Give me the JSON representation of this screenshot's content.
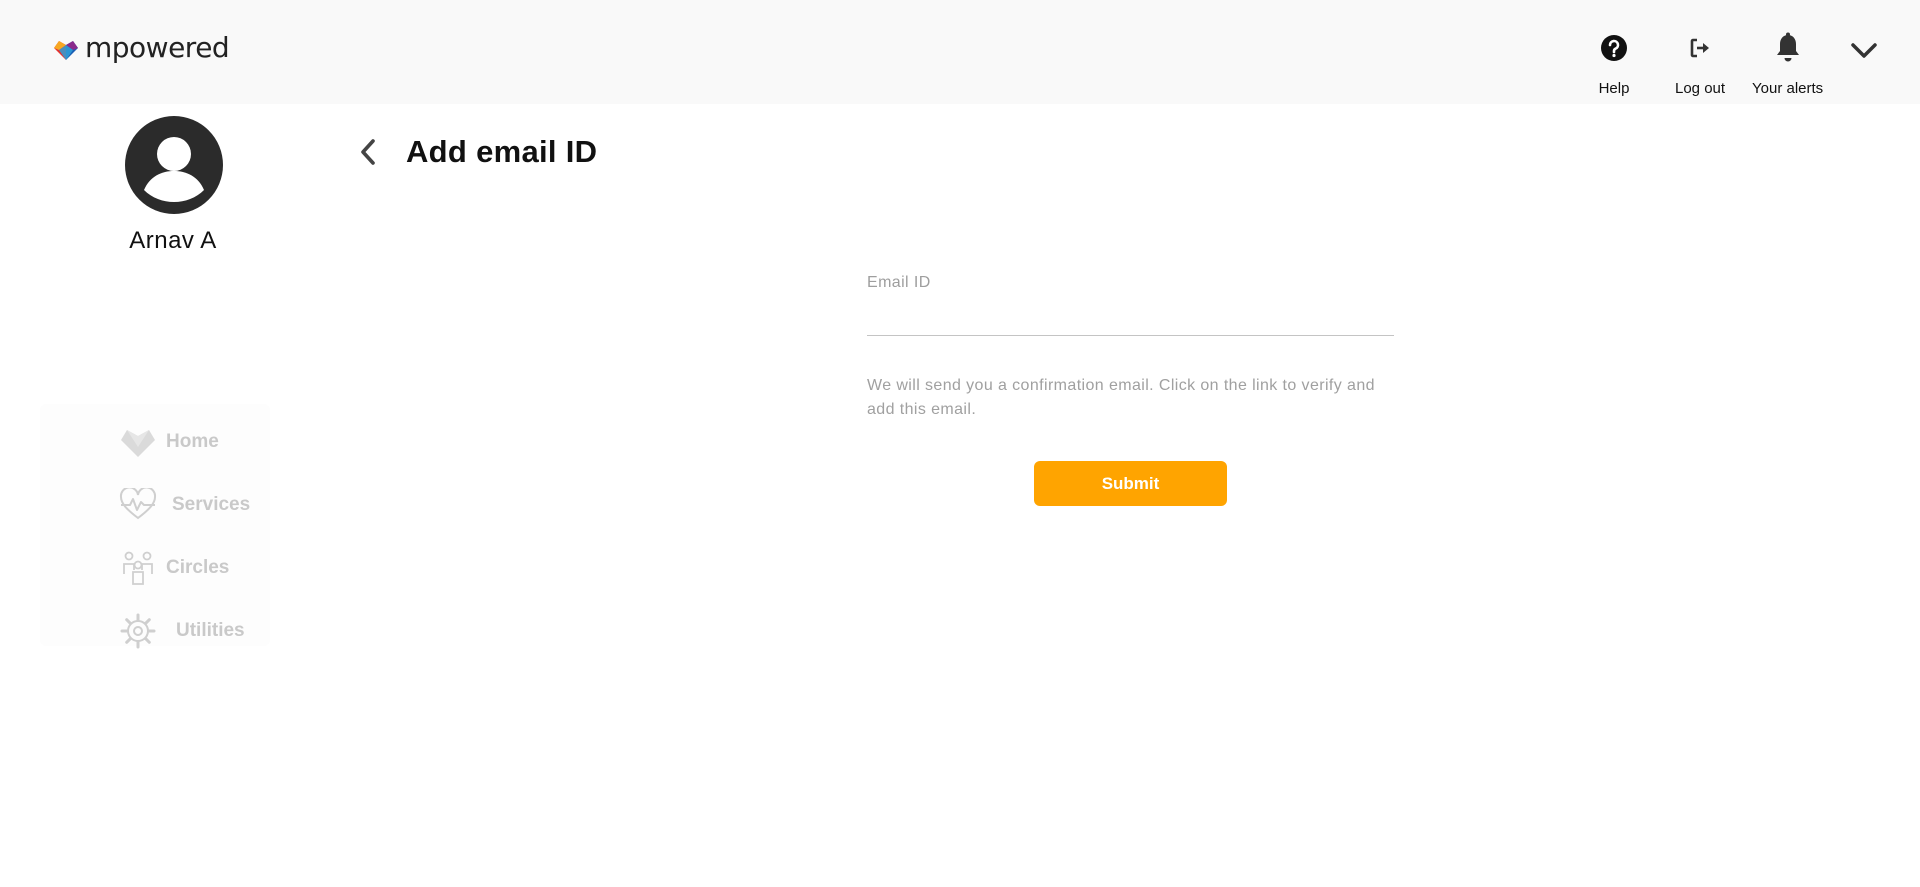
{
  "brand": {
    "name": "mpowered",
    "logo_icon": "heart-logo-icon"
  },
  "header": {
    "actions": [
      {
        "label": "Help",
        "icon": "help-circle-icon"
      },
      {
        "label": "Log out",
        "icon": "logout-icon"
      },
      {
        "label": "Your alerts",
        "icon": "bell-icon"
      }
    ],
    "menu_icon": "chevron-down-icon"
  },
  "profile": {
    "name": "Arnav A",
    "avatar_icon": "user-avatar-icon"
  },
  "nav": {
    "items": [
      {
        "label": "Home",
        "icon": "heart-home-icon"
      },
      {
        "label": "Services",
        "icon": "heart-pulse-icon"
      },
      {
        "label": "Circles",
        "icon": "people-icon"
      },
      {
        "label": "Utilities",
        "icon": "gear-icon"
      }
    ]
  },
  "page": {
    "title": "Add email ID",
    "back_icon": "chevron-left-icon"
  },
  "form": {
    "email_label": "Email ID",
    "email_value": "",
    "helper_text": "We will send you a confirmation email. Click on the link to verify and add this email.",
    "submit_label": "Submit"
  },
  "colors": {
    "accent": "#ffa400",
    "header_bg": "#f9f9f9",
    "nav_text": "#c9c9c9",
    "muted_text": "#a0a0a0"
  }
}
